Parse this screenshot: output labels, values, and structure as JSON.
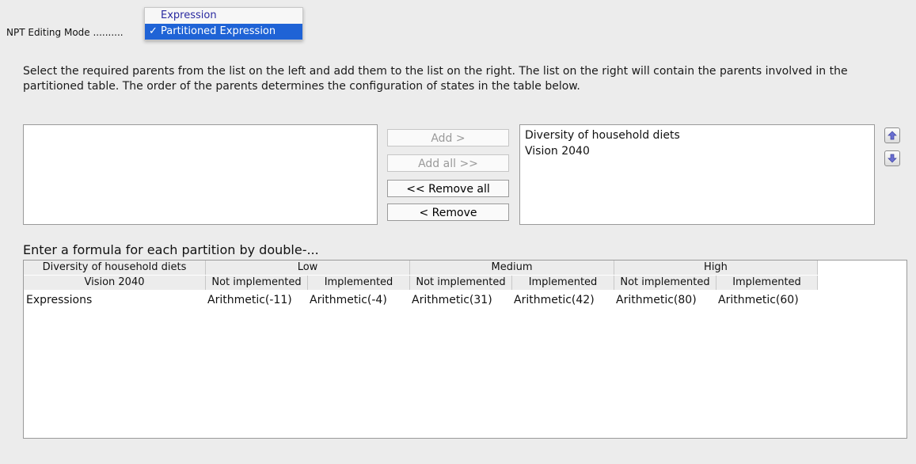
{
  "mode": {
    "label": "NPT Editing Mode ..........",
    "options": [
      {
        "label": "Expression",
        "selected": false
      },
      {
        "label": "Partitioned Expression",
        "selected": true
      }
    ],
    "check_glyph": "✓"
  },
  "instructions": "Select the required parents from the list on the left and add them to the list on the right. The list on the right will contain the parents involved in the partitioned table. The order of the parents determines the configuration of states in the table below.",
  "available_parents": [],
  "selected_parents": [
    "Diversity of household diets",
    "Vision 2040"
  ],
  "buttons": {
    "add": "Add >",
    "add_all": "Add all >>",
    "remove_all": "<< Remove all",
    "remove": "< Remove"
  },
  "icons": {
    "move_up": "arrow-up-icon",
    "move_down": "arrow-down-icon"
  },
  "colors": {
    "selection": "#1f63d6",
    "menu_text": "#2a2aa0"
  },
  "formula_label": "Enter a formula for each partition by double-...",
  "table": {
    "parent1_label": "Diversity of household diets",
    "parent2_label": "Vision 2040",
    "parent1_states": [
      "Low",
      "Medium",
      "High"
    ],
    "parent2_states": [
      "Not implemented",
      "Implemented",
      "Not implemented",
      "Implemented",
      "Not implemented",
      "Implemented"
    ],
    "row_label": "Expressions",
    "expressions": [
      "Arithmetic(-11)",
      "Arithmetic(-4)",
      "Arithmetic(31)",
      "Arithmetic(42)",
      "Arithmetic(80)",
      "Arithmetic(60)"
    ]
  }
}
